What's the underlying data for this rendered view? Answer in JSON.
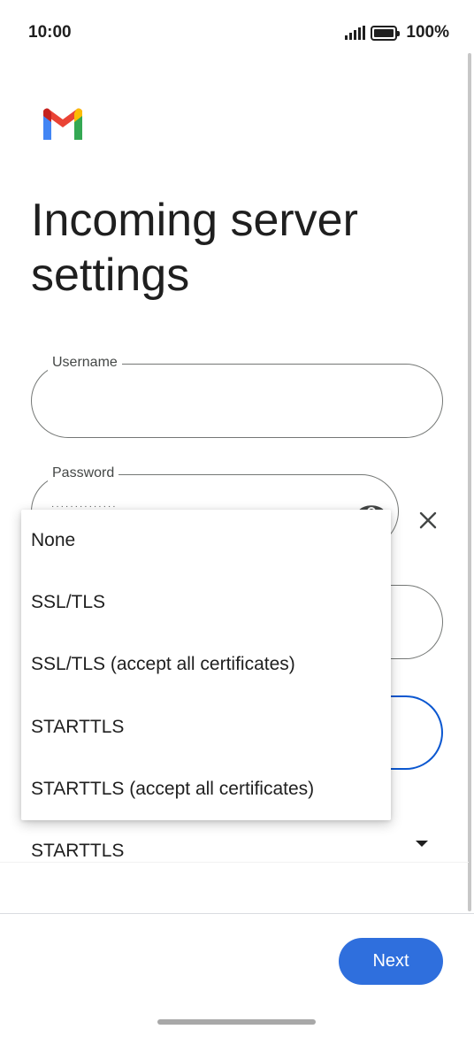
{
  "status_bar": {
    "time": "10:00",
    "battery": "100%",
    "signal_icon": "signal-bars-icon",
    "battery_icon": "battery-full-icon"
  },
  "header": {
    "logo_icon": "gmail-logo-icon",
    "title": "Incoming server settings"
  },
  "form": {
    "username": {
      "label": "Username",
      "value": ""
    },
    "password": {
      "label": "Password",
      "masked_value": "··············",
      "visibility_icon": "eye-icon",
      "clear_icon": "close-icon"
    },
    "security": {
      "selected": "STARTTLS",
      "options": [
        "None",
        "SSL/TLS",
        "SSL/TLS (accept all certificates)",
        "STARTTLS",
        "STARTTLS (accept all certificates)"
      ]
    }
  },
  "footer": {
    "next_label": "Next"
  },
  "colors": {
    "primary": "#2f6fdd",
    "focus_outline": "#0b57d0",
    "text": "#1f1f1f",
    "outline": "#747775"
  }
}
